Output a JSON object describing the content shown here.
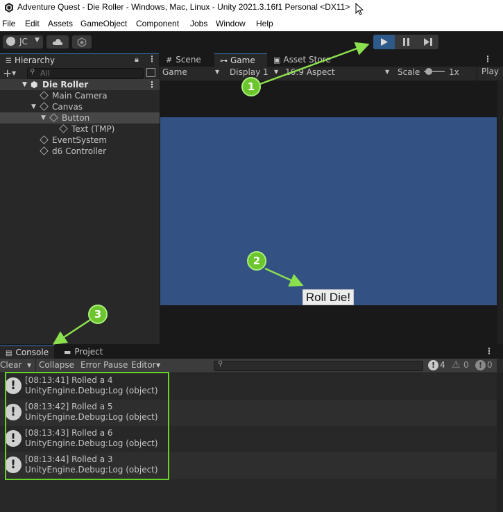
{
  "window": {
    "title": "Adventure Quest - Die Roller - Windows, Mac, Linux - Unity 2021.3.16f1 Personal <DX11>"
  },
  "menu": [
    "File",
    "Edit",
    "Assets",
    "GameObject",
    "Component",
    "Jobs",
    "Window",
    "Help"
  ],
  "toolbar": {
    "account_label": "JC"
  },
  "hierarchy": {
    "tab_label": "Hierarchy",
    "search_placeholder": "All",
    "scene_name": "Die Roller",
    "items": [
      "Main Camera",
      "Canvas",
      "Button",
      "Text (TMP)",
      "EventSystem",
      "d6 Controller"
    ]
  },
  "center_tabs": [
    "Scene",
    "Game",
    "Asset Store"
  ],
  "game_toolbar": {
    "mode": "Game",
    "display": "Display 1",
    "aspect": "16:9 Aspect",
    "scale_label": "Scale",
    "scale_value": "1x",
    "play_label": "Play"
  },
  "game_view": {
    "button_label": "Roll Die!"
  },
  "console": {
    "tabs": [
      "Console",
      "Project"
    ],
    "toolbar": [
      "Clear",
      "Collapse",
      "Error Pause",
      "Editor"
    ],
    "counts": {
      "log": "4",
      "warning": "0",
      "error": "0"
    },
    "entries": [
      {
        "line1": "[08:13:41] Rolled a 4",
        "line2": "UnityEngine.Debug:Log (object)"
      },
      {
        "line1": "[08:13:42] Rolled a 5",
        "line2": "UnityEngine.Debug:Log (object)"
      },
      {
        "line1": "[08:13:43] Rolled a 6",
        "line2": "UnityEngine.Debug:Log (object)"
      },
      {
        "line1": "[08:13:44] Rolled a 3",
        "line2": "UnityEngine.Debug:Log (object)"
      }
    ]
  },
  "callouts": [
    "1",
    "2",
    "3"
  ],
  "colors": {
    "accent": "#6cc52d",
    "game_view_bg": "#335182",
    "play_active": "#2e5a8a"
  }
}
